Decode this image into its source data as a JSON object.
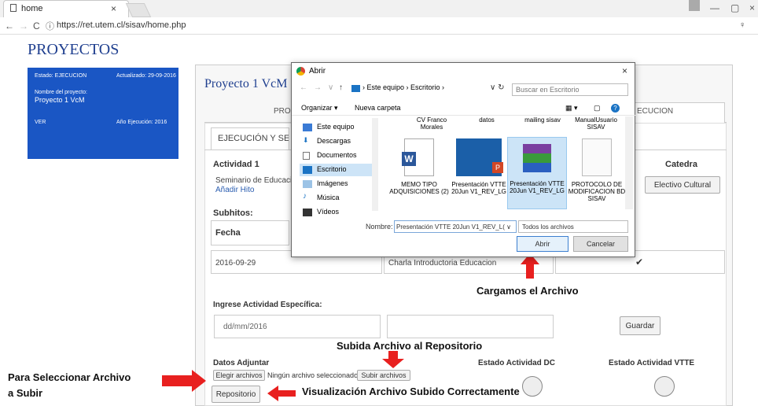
{
  "browser": {
    "tab_title": "home",
    "tab_close": "×",
    "url": "https://ret.utem.cl/sisav/home.php"
  },
  "page": {
    "title": "PROYECTOS",
    "card": {
      "estado": "Estado: EJECUCION",
      "actualizado": "Actualizado: 29-09-2016",
      "nombre_label": "Nombre del proyecto:",
      "nombre": "Proyecto 1 VcM",
      "ver": "VER",
      "anio": "Año Ejecución: 2016"
    },
    "project_title": "Proyecto 1 VcM",
    "tab_left": "PROY",
    "tab_right": "ECUCION",
    "subtab": "EJECUCIÓN Y SEGUI",
    "actividad_label": "Actividad 1",
    "actividad_text": "Seminario de Educación",
    "add_hito": "Añadir Hito",
    "catedra_header": "Catedra",
    "catedra_value": "Electivo Cultural",
    "subhitos_label": "Subhitos:",
    "fecha_header": "Fecha",
    "row_date": "2016-09-29",
    "row_desc": "Charla Introductoria Educacion",
    "row_check": "✔",
    "ingrese_label": "Ingrese Actividad Específica:",
    "date_placeholder": "dd/mm/2016",
    "guardar": "Guardar",
    "datos_adjuntar": "Datos Adjuntar",
    "elegir": "Elegir archivos",
    "ninguno": "Ningún archivo seleccionado",
    "subir": "Subir archivos",
    "estado_dc": "Estado Actividad DC",
    "estado_vtte": "Estado Actividad VTTE",
    "repositorio": "Repositorio"
  },
  "annotations": {
    "cargamos": "Cargamos el Archivo",
    "subida": "Subida Archivo al Repositorio",
    "seleccionar_1": "Para Seleccionar Archivo",
    "seleccionar_2": "a Subir",
    "visualizacion": "Visualización Archivo Subido Correctamente"
  },
  "dialog": {
    "title": "Abrir",
    "crumb": "› Este equipo › Escritorio ›",
    "search_placeholder": "Buscar en Escritorio",
    "organizar": "Organizar ▾",
    "nueva_carpeta": "Nueva carpeta",
    "sidebar": [
      {
        "label": "Este equipo",
        "icon": "computer-icon"
      },
      {
        "label": "Descargas",
        "icon": "download-icon"
      },
      {
        "label": "Documentos",
        "icon": "documents-icon"
      },
      {
        "label": "Escritorio",
        "icon": "desktop-icon",
        "selected": true
      },
      {
        "label": "Imágenes",
        "icon": "images-icon"
      },
      {
        "label": "Música",
        "icon": "music-icon"
      },
      {
        "label": "Vídeos",
        "icon": "videos-icon"
      }
    ],
    "top_files": [
      "CV Franco Morales",
      "datos",
      "mailing sisav",
      "ManualUsuario SISAV"
    ],
    "files": [
      {
        "name": "MEMO TIPO ADQUISICIONES (2)",
        "icon": "word-icon"
      },
      {
        "name": "Presentación VTTE 20Jun V1_REV_LG",
        "icon": "powerpoint-icon"
      },
      {
        "name": "Presentación VTTE 20Jun V1_REV_LG",
        "icon": "winrar-icon",
        "selected": true
      },
      {
        "name": "PROTOCOLO DE MODIFICACION BD SISAV",
        "icon": "document-icon"
      }
    ],
    "nombre_label": "Nombre:",
    "nombre_value": "Presentación VTTE 20Jun V1_REV_L( ∨",
    "tipo": "Todos los archivos",
    "abrir": "Abrir",
    "cancelar": "Cancelar"
  },
  "colors": {
    "card_bg": "#1a56c4",
    "title_blue": "#1f3f8f",
    "arrow_red": "#e8201f"
  }
}
